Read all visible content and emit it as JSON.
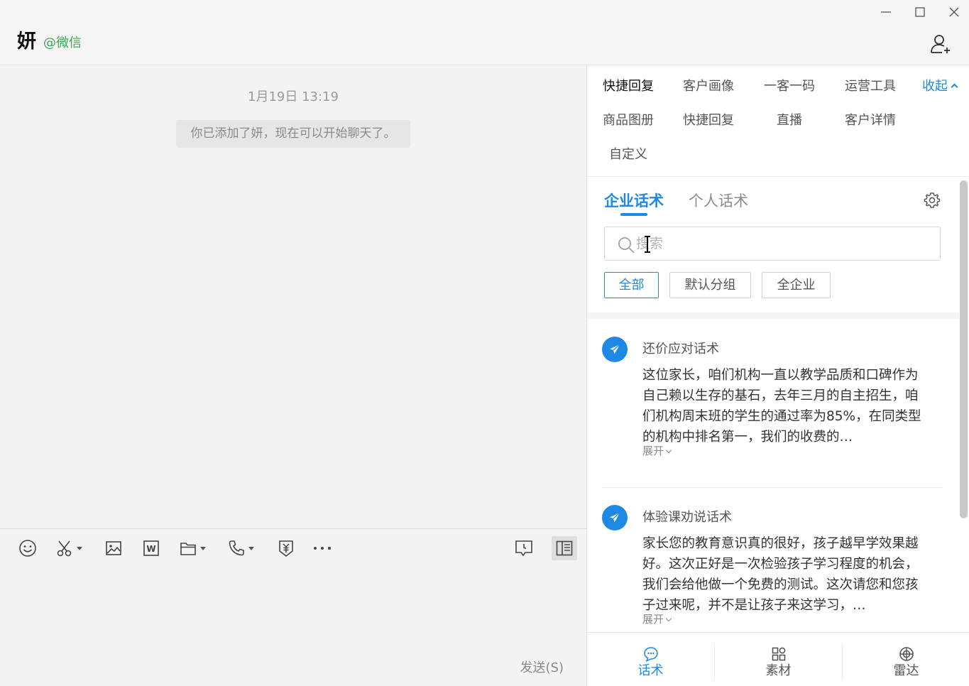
{
  "header": {
    "contact_name": "妍",
    "contact_source": "@微信"
  },
  "chat": {
    "timestamp": "1月19日 13:19",
    "system_message": "你已添加了妍，现在可以开始聊天了。"
  },
  "input": {
    "send_label": "发送(S)"
  },
  "quick_nav": {
    "items": [
      "快捷回复",
      "客户画像",
      "一客一码",
      "运营工具",
      "商品图册",
      "快捷回复",
      "直播",
      "客户详情",
      "自定义"
    ],
    "collapse_label": "收起"
  },
  "scripts_panel": {
    "tabs": [
      "企业话术",
      "个人话术"
    ],
    "active_tab": "企业话术",
    "search_placeholder": "搜索",
    "filters": [
      "全部",
      "默认分组",
      "全企业"
    ],
    "active_filter": "全部",
    "items": [
      {
        "title": "还价应对话术",
        "body": "这位家长，咱们机构一直以教学品质和口碑作为自己赖以生存的基石，去年三月的自主招生，咱们机构周末班的学生的通过率为85%，在同类型的机构中排名第一，我们的收费的…",
        "expand_label": "展开"
      },
      {
        "title": "体验课劝说话术",
        "body": "家长您的教育意识真的很好，孩子越早学效果越好。这次正好是一次检验孩子学习程度的机会，我们会给他做一个免费的测试。这次请您和您孩子过来呢，并不是让孩子来这学习，…",
        "expand_label": "展开"
      }
    ]
  },
  "bottom_nav": {
    "items": [
      "话术",
      "素材",
      "雷达"
    ],
    "active": "话术"
  },
  "colors": {
    "accent": "#1e88e5",
    "source_green": "#3fa652"
  }
}
